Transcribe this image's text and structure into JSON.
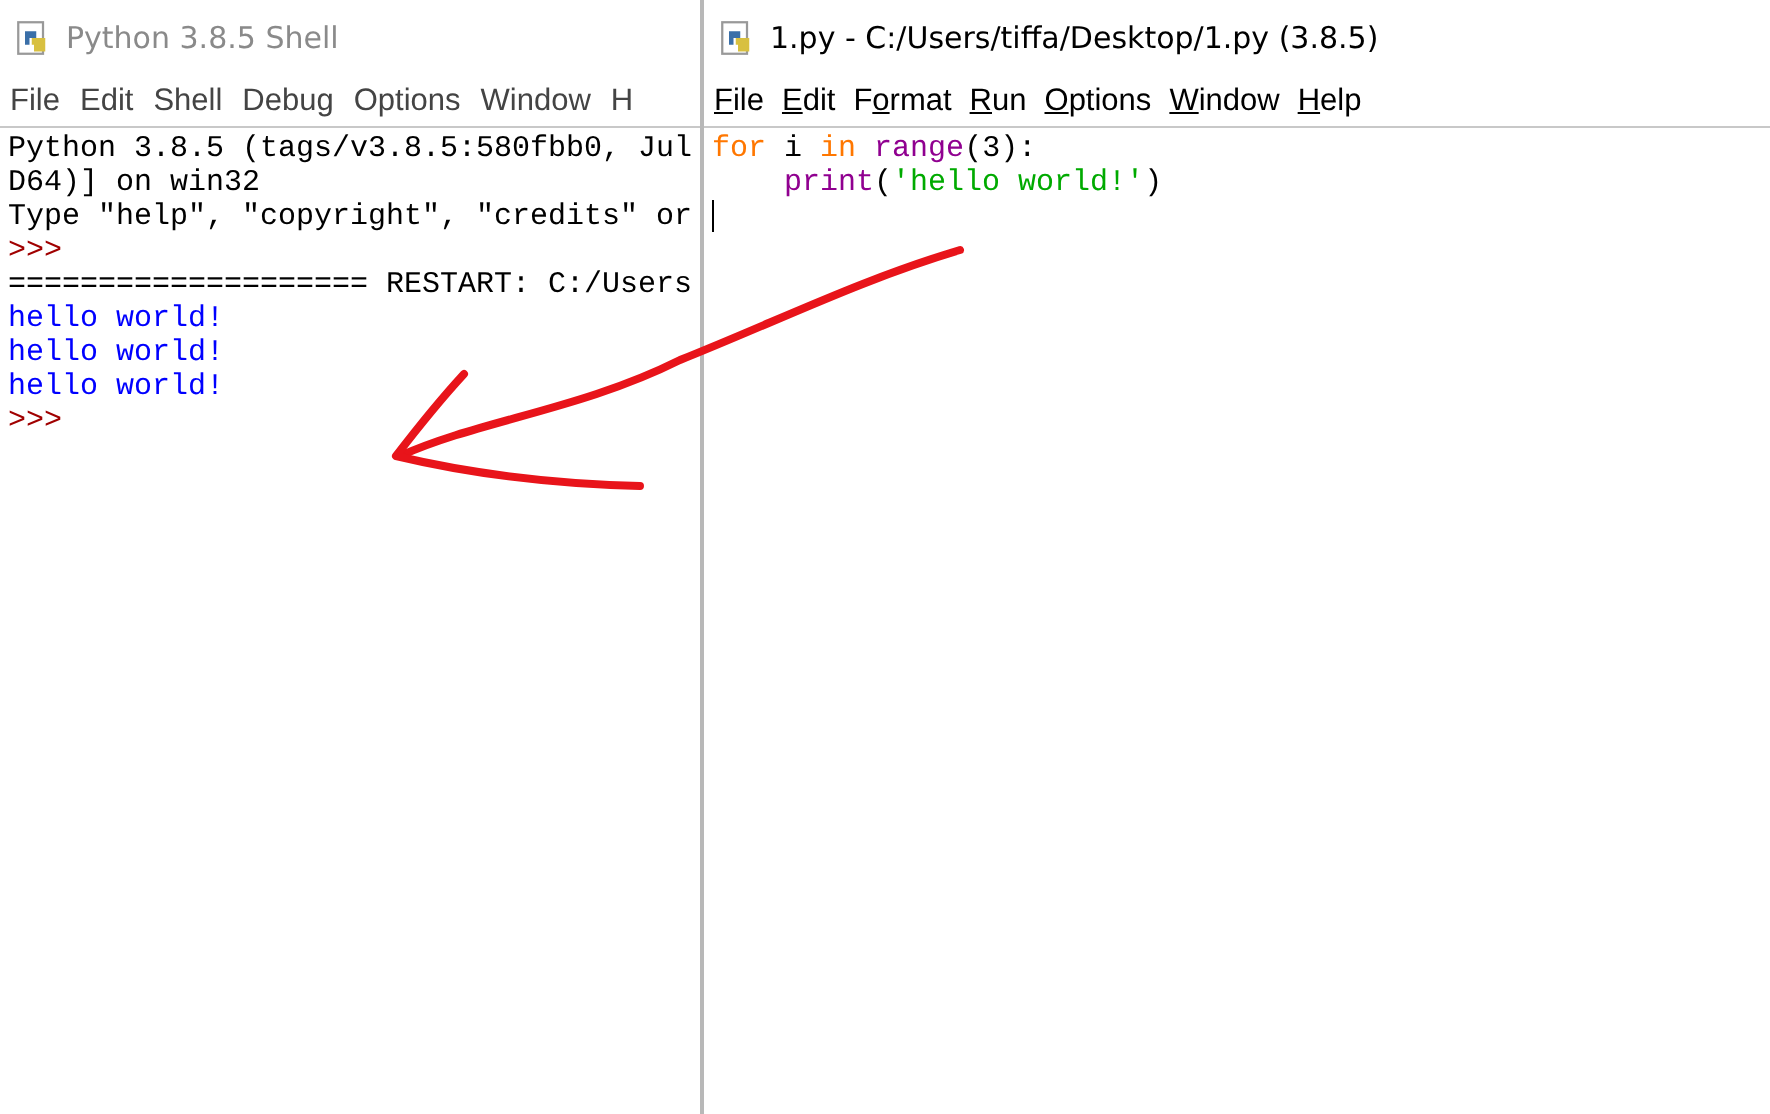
{
  "shell_window": {
    "title": "Python 3.8.5 Shell",
    "menu": [
      {
        "label": "File"
      },
      {
        "label": "Edit"
      },
      {
        "label": "Shell"
      },
      {
        "label": "Debug"
      },
      {
        "label": "Options"
      },
      {
        "label": "Window"
      },
      {
        "label": "H"
      }
    ],
    "lines": [
      {
        "kind": "info",
        "text": "Python 3.8.5 (tags/v3.8.5:580fbb0, Jul"
      },
      {
        "kind": "info",
        "text": "D64)] on win32"
      },
      {
        "kind": "info",
        "text": "Type \"help\", \"copyright\", \"credits\" or"
      },
      {
        "kind": "prompt",
        "text": ">>>"
      },
      {
        "kind": "info",
        "text": "==================== RESTART: C:/Users"
      },
      {
        "kind": "stdout",
        "text": "hello world!"
      },
      {
        "kind": "stdout",
        "text": "hello world!"
      },
      {
        "kind": "stdout",
        "text": "hello world!"
      },
      {
        "kind": "prompt",
        "text": ">>>"
      }
    ]
  },
  "editor_window": {
    "title": "1.py - C:/Users/tiffa/Desktop/1.py (3.8.5)",
    "menu": [
      {
        "key": "F",
        "rest": "ile"
      },
      {
        "key": "E",
        "rest": "dit"
      },
      {
        "pre": "F",
        "key": "o",
        "rest": "rmat"
      },
      {
        "key": "R",
        "rest": "un"
      },
      {
        "key": "O",
        "rest": "ptions"
      },
      {
        "key": "W",
        "rest": "indow"
      },
      {
        "key": "H",
        "rest": "elp"
      }
    ],
    "code": [
      [
        {
          "kind": "keyword",
          "text": "for"
        },
        {
          "kind": "plain",
          "text": " i "
        },
        {
          "kind": "keyword",
          "text": "in"
        },
        {
          "kind": "builtin",
          "text": " range"
        },
        {
          "kind": "plain",
          "text": "(3):"
        }
      ],
      [
        {
          "kind": "builtin",
          "text": "    print"
        },
        {
          "kind": "plain",
          "text": "("
        },
        {
          "kind": "string",
          "text": "'hello world!'"
        },
        {
          "kind": "plain",
          "text": ")"
        }
      ]
    ]
  }
}
